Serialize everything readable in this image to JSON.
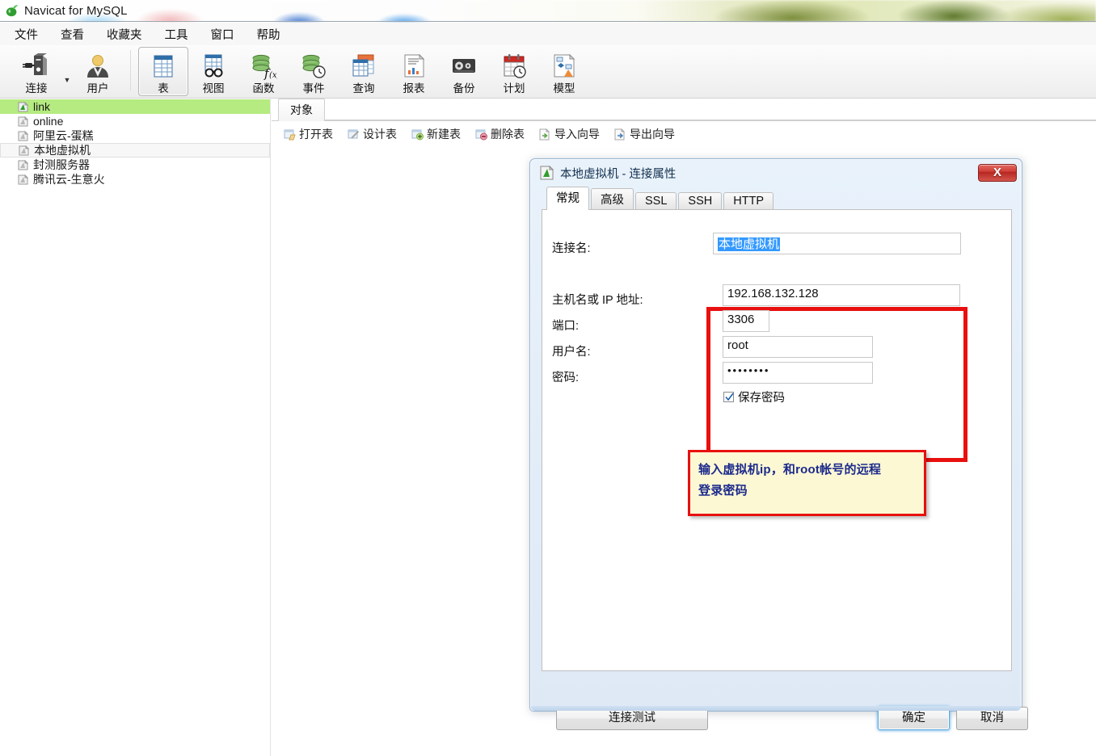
{
  "window": {
    "app_title": "Navicat for MySQL",
    "logo_icon": "navicat-logo-icon"
  },
  "menubar": {
    "items": [
      {
        "label": "文件"
      },
      {
        "label": "查看"
      },
      {
        "label": "收藏夹"
      },
      {
        "label": "工具"
      },
      {
        "label": "窗口"
      },
      {
        "label": "帮助"
      }
    ]
  },
  "toolbar": {
    "items": [
      {
        "label": "连接",
        "icon": "connection-icon",
        "selected": false
      },
      {
        "label": "用户",
        "icon": "user-icon",
        "selected": false
      },
      {
        "label": "表",
        "icon": "table-icon",
        "selected": true
      },
      {
        "label": "视图",
        "icon": "view-icon",
        "selected": false
      },
      {
        "label": "函数",
        "icon": "function-icon",
        "selected": false
      },
      {
        "label": "事件",
        "icon": "event-icon",
        "selected": false
      },
      {
        "label": "查询",
        "icon": "query-icon",
        "selected": false
      },
      {
        "label": "报表",
        "icon": "report-icon",
        "selected": false
      },
      {
        "label": "备份",
        "icon": "backup-icon",
        "selected": false
      },
      {
        "label": "计划",
        "icon": "schedule-icon",
        "selected": false
      },
      {
        "label": "模型",
        "icon": "model-icon",
        "selected": false
      }
    ]
  },
  "sidebar": {
    "items": [
      {
        "label": "link",
        "state": "selected"
      },
      {
        "label": "online",
        "state": "normal"
      },
      {
        "label": "阿里云-蛋糕",
        "state": "normal"
      },
      {
        "label": "本地虚拟机",
        "state": "focused"
      },
      {
        "label": "封测服务器",
        "state": "normal"
      },
      {
        "label": "腾讯云-生意火",
        "state": "normal"
      }
    ]
  },
  "object_pane": {
    "tab_label": "对象",
    "actions": [
      {
        "label": "打开表",
        "icon": "open-table-icon"
      },
      {
        "label": "设计表",
        "icon": "design-table-icon"
      },
      {
        "label": "新建表",
        "icon": "new-table-icon"
      },
      {
        "label": "删除表",
        "icon": "delete-table-icon"
      },
      {
        "label": "导入向导",
        "icon": "import-wizard-icon"
      },
      {
        "label": "导出向导",
        "icon": "export-wizard-icon"
      }
    ]
  },
  "dialog": {
    "title": "本地虚拟机 - 连接属性",
    "icon": "navicat-connection-icon",
    "close_label": "X",
    "tabs": [
      {
        "label": "常规",
        "active": true
      },
      {
        "label": "高级",
        "active": false
      },
      {
        "label": "SSL",
        "active": false
      },
      {
        "label": "SSH",
        "active": false
      },
      {
        "label": "HTTP",
        "active": false
      }
    ],
    "fields": {
      "connection_name": {
        "label": "连接名:",
        "value": "本地虚拟机",
        "selected": true
      },
      "host": {
        "label": "主机名或 IP 地址:",
        "value": "192.168.132.128"
      },
      "port": {
        "label": "端口:",
        "value": "3306"
      },
      "username": {
        "label": "用户名:",
        "value": "root"
      },
      "password": {
        "label": "密码:",
        "value": "••••••••"
      }
    },
    "save_password": {
      "label": "保存密码",
      "checked": true
    },
    "buttons": {
      "test": "连接测试",
      "ok": "确定",
      "cancel": "取消"
    }
  },
  "annotation": {
    "line1": "输入虚拟机ip，和root帐号的远程",
    "line2": "登录密码"
  },
  "colors": {
    "highlight_red": "#e8100f",
    "note_background": "#fdf8d4",
    "note_text": "#1b2a8c",
    "tree_selected": "#b5eb80",
    "text_selection": "#3399ff"
  }
}
